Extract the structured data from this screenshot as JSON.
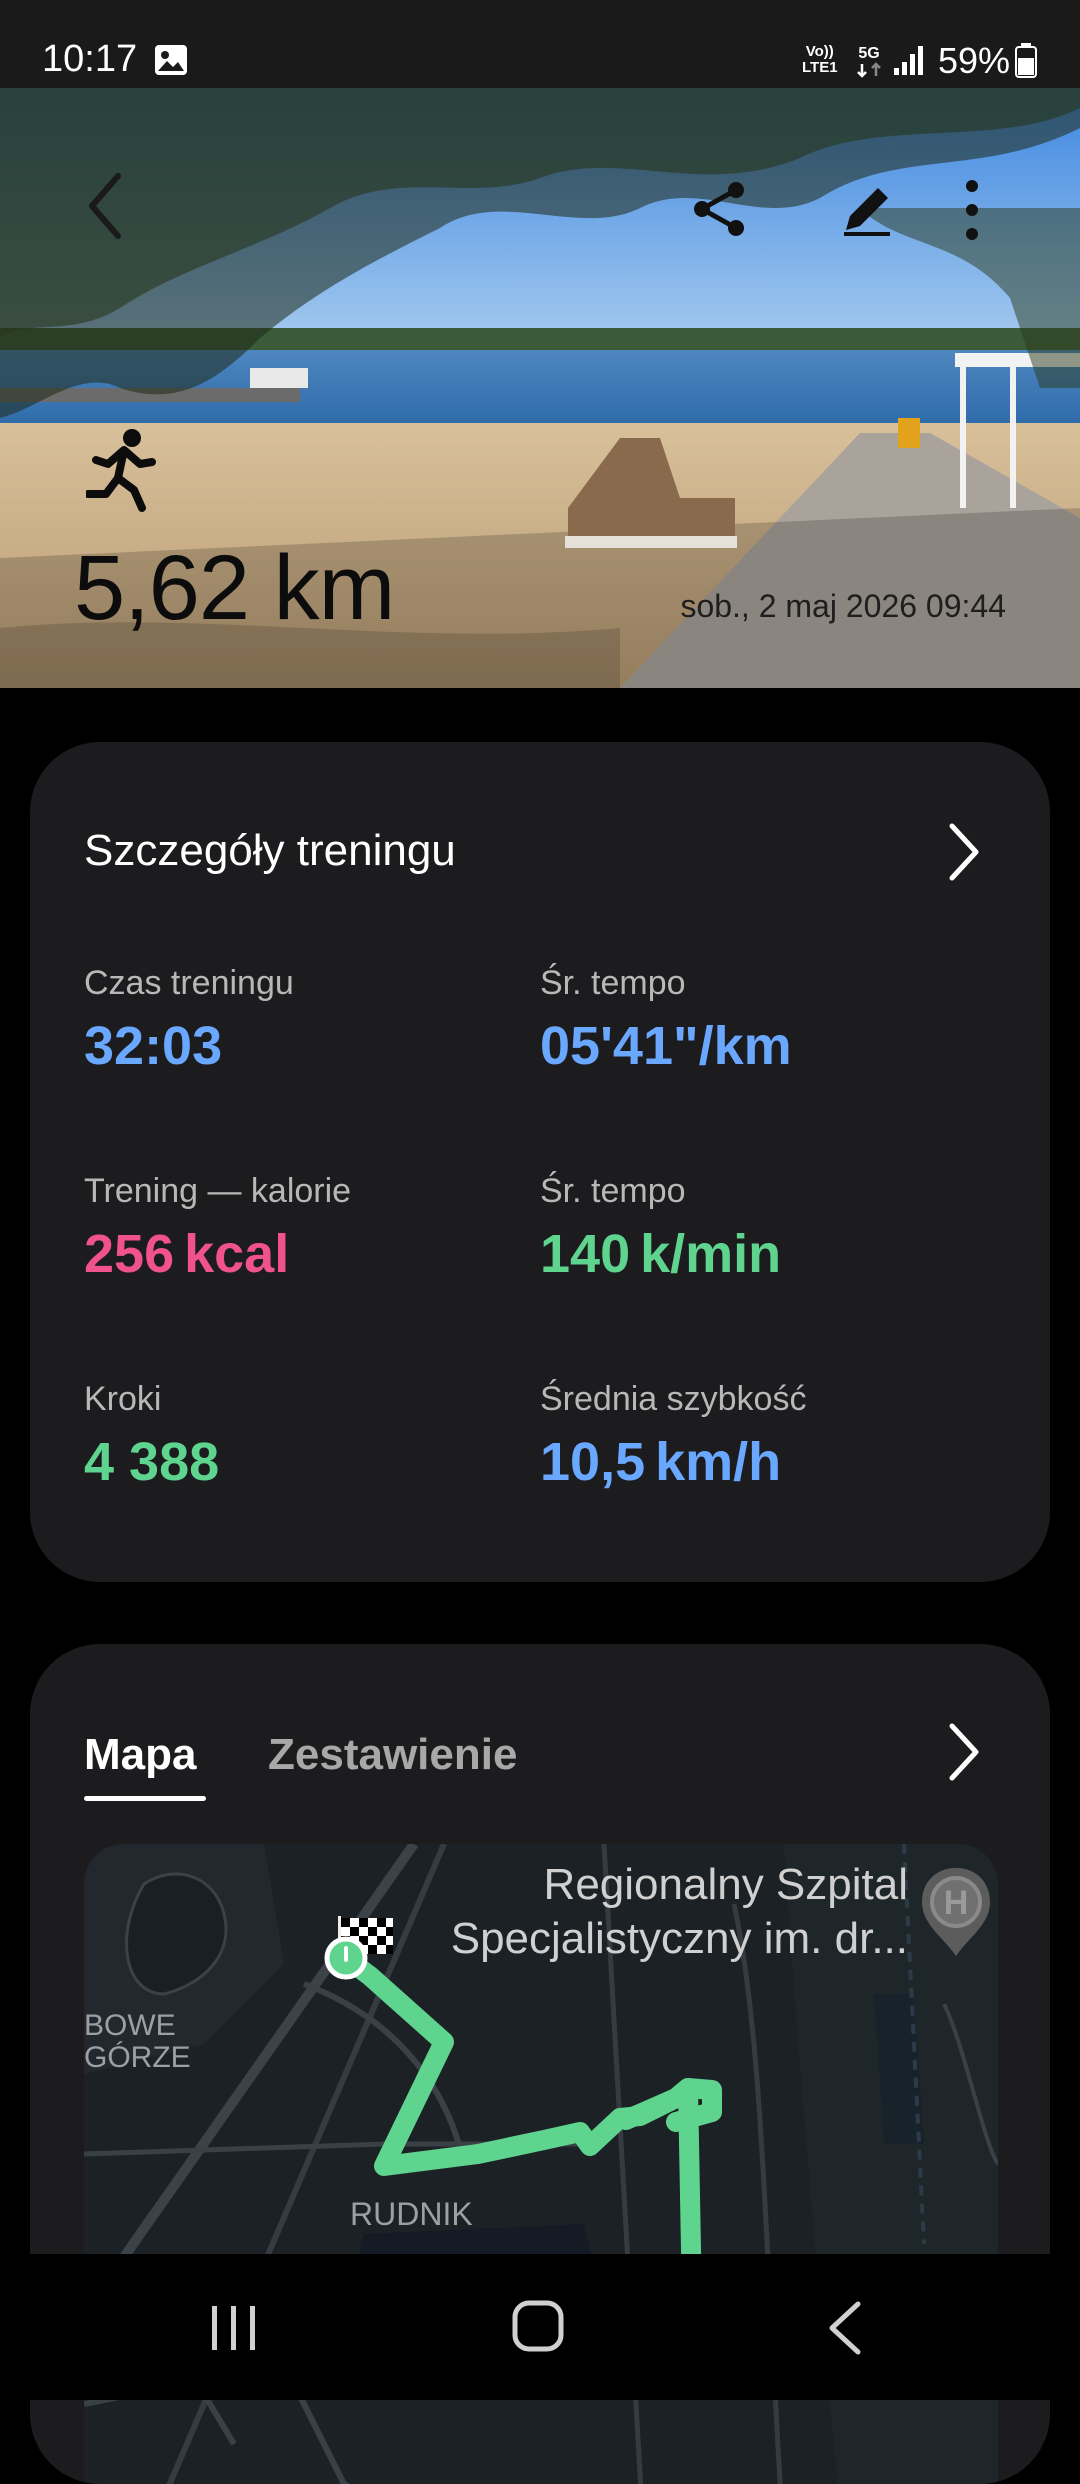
{
  "status_bar": {
    "time": "10:17",
    "volte_line1": "Vo))",
    "volte_line2": "LTE1",
    "network": "5G",
    "battery": "59%"
  },
  "hero": {
    "distance": "5,62 km",
    "date": "sob., 2 maj 2026 09:44",
    "activity_icon": "running-person-icon",
    "toolbar_icons": [
      "back-icon",
      "share-icon",
      "edit-icon",
      "more-icon"
    ]
  },
  "details": {
    "title": "Szczegóły treningu",
    "metrics": [
      {
        "label": "Czas treningu",
        "value": "32:03",
        "unit": "",
        "color": "#6aa8ff"
      },
      {
        "label": "Śr. tempo",
        "value": "05'41\"/km",
        "unit": "",
        "color": "#6aa8ff"
      },
      {
        "label": "Trening — kalorie",
        "value": "256",
        "unit": "kcal",
        "color": "#f0528d"
      },
      {
        "label": "Śr. tempo",
        "value": "140",
        "unit": "k/min",
        "color": "#5fd48e"
      },
      {
        "label": "Kroki",
        "value": "4 388",
        "unit": "",
        "color": "#5fd48e"
      },
      {
        "label": "Średnia szybkość",
        "value": "10,5",
        "unit": "km/h",
        "color": "#6aa8ff"
      }
    ]
  },
  "map_card": {
    "tabs": [
      "Mapa",
      "Zestawienie"
    ],
    "active_tab": "Mapa",
    "hospital_label_line1": "Regionalny Szpital",
    "hospital_label_line2": "Specjalistyczny im. dr...",
    "hospital_marker": "H",
    "district_label_line1": "BOWE",
    "district_label_line2": "GÓRZE",
    "area_label": "RUDNIK",
    "route_color": "#5fd48e"
  }
}
